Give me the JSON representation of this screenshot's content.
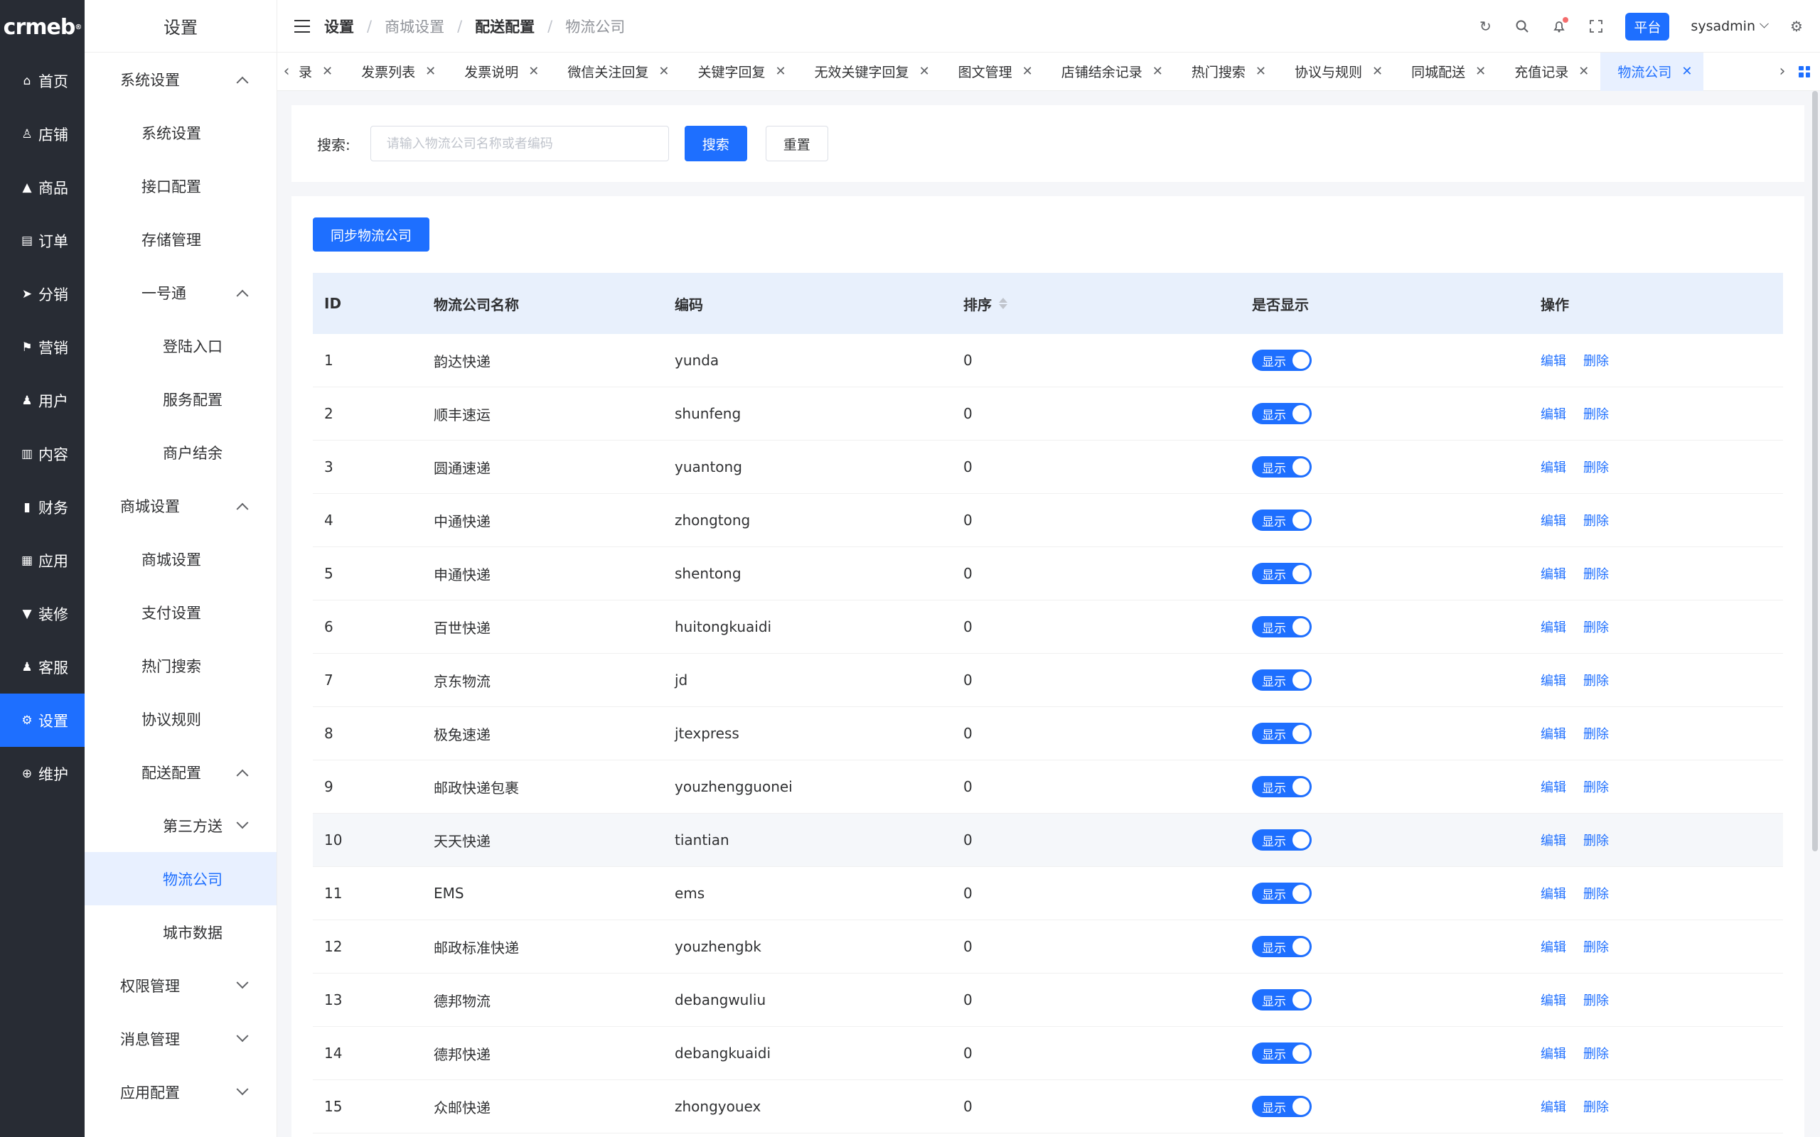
{
  "logo": "crmeb",
  "rail": [
    {
      "label": "首页",
      "icon": "home-icon",
      "glyph": "⌂"
    },
    {
      "label": "店铺",
      "icon": "store-icon",
      "glyph": "♙"
    },
    {
      "label": "商品",
      "icon": "product-icon",
      "glyph": "▲"
    },
    {
      "label": "订单",
      "icon": "order-icon",
      "glyph": "▤"
    },
    {
      "label": "分销",
      "icon": "distribution-icon",
      "glyph": "➤"
    },
    {
      "label": "营销",
      "icon": "marketing-icon",
      "glyph": "⚑"
    },
    {
      "label": "用户",
      "icon": "user-icon",
      "glyph": "♟"
    },
    {
      "label": "内容",
      "icon": "content-icon",
      "glyph": "▥"
    },
    {
      "label": "财务",
      "icon": "finance-icon",
      "glyph": "▮"
    },
    {
      "label": "应用",
      "icon": "apps-icon",
      "glyph": "▦"
    },
    {
      "label": "装修",
      "icon": "decorate-icon",
      "glyph": "▼"
    },
    {
      "label": "客服",
      "icon": "service-icon",
      "glyph": "♟"
    },
    {
      "label": "设置",
      "icon": "gear-icon",
      "glyph": "⚙"
    },
    {
      "label": "维护",
      "icon": "maintenance-icon",
      "glyph": "⊕"
    }
  ],
  "submenu": {
    "title": "设置",
    "items": [
      {
        "label": "系统设置",
        "level": 1,
        "chevron": "up"
      },
      {
        "label": "系统设置",
        "level": 2
      },
      {
        "label": "接口配置",
        "level": 2
      },
      {
        "label": "存储管理",
        "level": 2
      },
      {
        "label": "一号通",
        "level": 2,
        "chevron": "up"
      },
      {
        "label": "登陆入口",
        "level": 3
      },
      {
        "label": "服务配置",
        "level": 3
      },
      {
        "label": "商户结余",
        "level": 3
      },
      {
        "label": "商城设置",
        "level": 1,
        "chevron": "up"
      },
      {
        "label": "商城设置",
        "level": 2
      },
      {
        "label": "支付设置",
        "level": 2
      },
      {
        "label": "热门搜索",
        "level": 2
      },
      {
        "label": "协议规则",
        "level": 2
      },
      {
        "label": "配送配置",
        "level": 2,
        "chevron": "up"
      },
      {
        "label": "第三方送",
        "level": 3,
        "chevron": "down"
      },
      {
        "label": "物流公司",
        "level": 3,
        "active": true
      },
      {
        "label": "城市数据",
        "level": 3
      },
      {
        "label": "权限管理",
        "level": 1,
        "chevron": "down"
      },
      {
        "label": "消息管理",
        "level": 1,
        "chevron": "down"
      },
      {
        "label": "应用配置",
        "level": 1,
        "chevron": "down"
      }
    ]
  },
  "breadcrumb": [
    "设置",
    "商城设置",
    "配送配置",
    "物流公司"
  ],
  "header": {
    "platform": "平台",
    "username": "sysadmin"
  },
  "tabs": [
    {
      "label": "录"
    },
    {
      "label": "发票列表"
    },
    {
      "label": "发票说明"
    },
    {
      "label": "微信关注回复"
    },
    {
      "label": "关键字回复"
    },
    {
      "label": "无效关键字回复"
    },
    {
      "label": "图文管理"
    },
    {
      "label": "店铺结余记录"
    },
    {
      "label": "热门搜索"
    },
    {
      "label": "协议与规则"
    },
    {
      "label": "同城配送"
    },
    {
      "label": "充值记录"
    },
    {
      "label": "物流公司",
      "active": true
    }
  ],
  "search": {
    "label": "搜索:",
    "placeholder": "请输入物流公司名称或者编码",
    "value": "",
    "search_btn": "搜索",
    "reset_btn": "重置"
  },
  "sync_btn": "同步物流公司",
  "table": {
    "headers": {
      "id": "ID",
      "name": "物流公司名称",
      "code": "编码",
      "sort": "排序",
      "show": "是否显示",
      "op": "操作"
    },
    "switch_label": "显示",
    "edit": "编辑",
    "delete": "删除",
    "rows": [
      {
        "id": "1",
        "name": "韵达快递",
        "code": "yunda",
        "sort": "0"
      },
      {
        "id": "2",
        "name": "顺丰速运",
        "code": "shunfeng",
        "sort": "0"
      },
      {
        "id": "3",
        "name": "圆通速递",
        "code": "yuantong",
        "sort": "0"
      },
      {
        "id": "4",
        "name": "中通快递",
        "code": "zhongtong",
        "sort": "0"
      },
      {
        "id": "5",
        "name": "申通快递",
        "code": "shentong",
        "sort": "0"
      },
      {
        "id": "6",
        "name": "百世快递",
        "code": "huitongkuaidi",
        "sort": "0"
      },
      {
        "id": "7",
        "name": "京东物流",
        "code": "jd",
        "sort": "0"
      },
      {
        "id": "8",
        "name": "极兔速递",
        "code": "jtexpress",
        "sort": "0"
      },
      {
        "id": "9",
        "name": "邮政快递包裹",
        "code": "youzhengguonei",
        "sort": "0"
      },
      {
        "id": "10",
        "name": "天天快递",
        "code": "tiantian",
        "sort": "0"
      },
      {
        "id": "11",
        "name": "EMS",
        "code": "ems",
        "sort": "0"
      },
      {
        "id": "12",
        "name": "邮政标准快递",
        "code": "youzhengbk",
        "sort": "0"
      },
      {
        "id": "13",
        "name": "德邦物流",
        "code": "debangwuliu",
        "sort": "0"
      },
      {
        "id": "14",
        "name": "德邦快递",
        "code": "debangkuaidi",
        "sort": "0"
      },
      {
        "id": "15",
        "name": "众邮快递",
        "code": "zhongyouex",
        "sort": "0"
      }
    ]
  },
  "colors": {
    "accent": "#1e6fff",
    "rail_bg": "#282c34",
    "table_header_bg": "#e8f0fc"
  }
}
